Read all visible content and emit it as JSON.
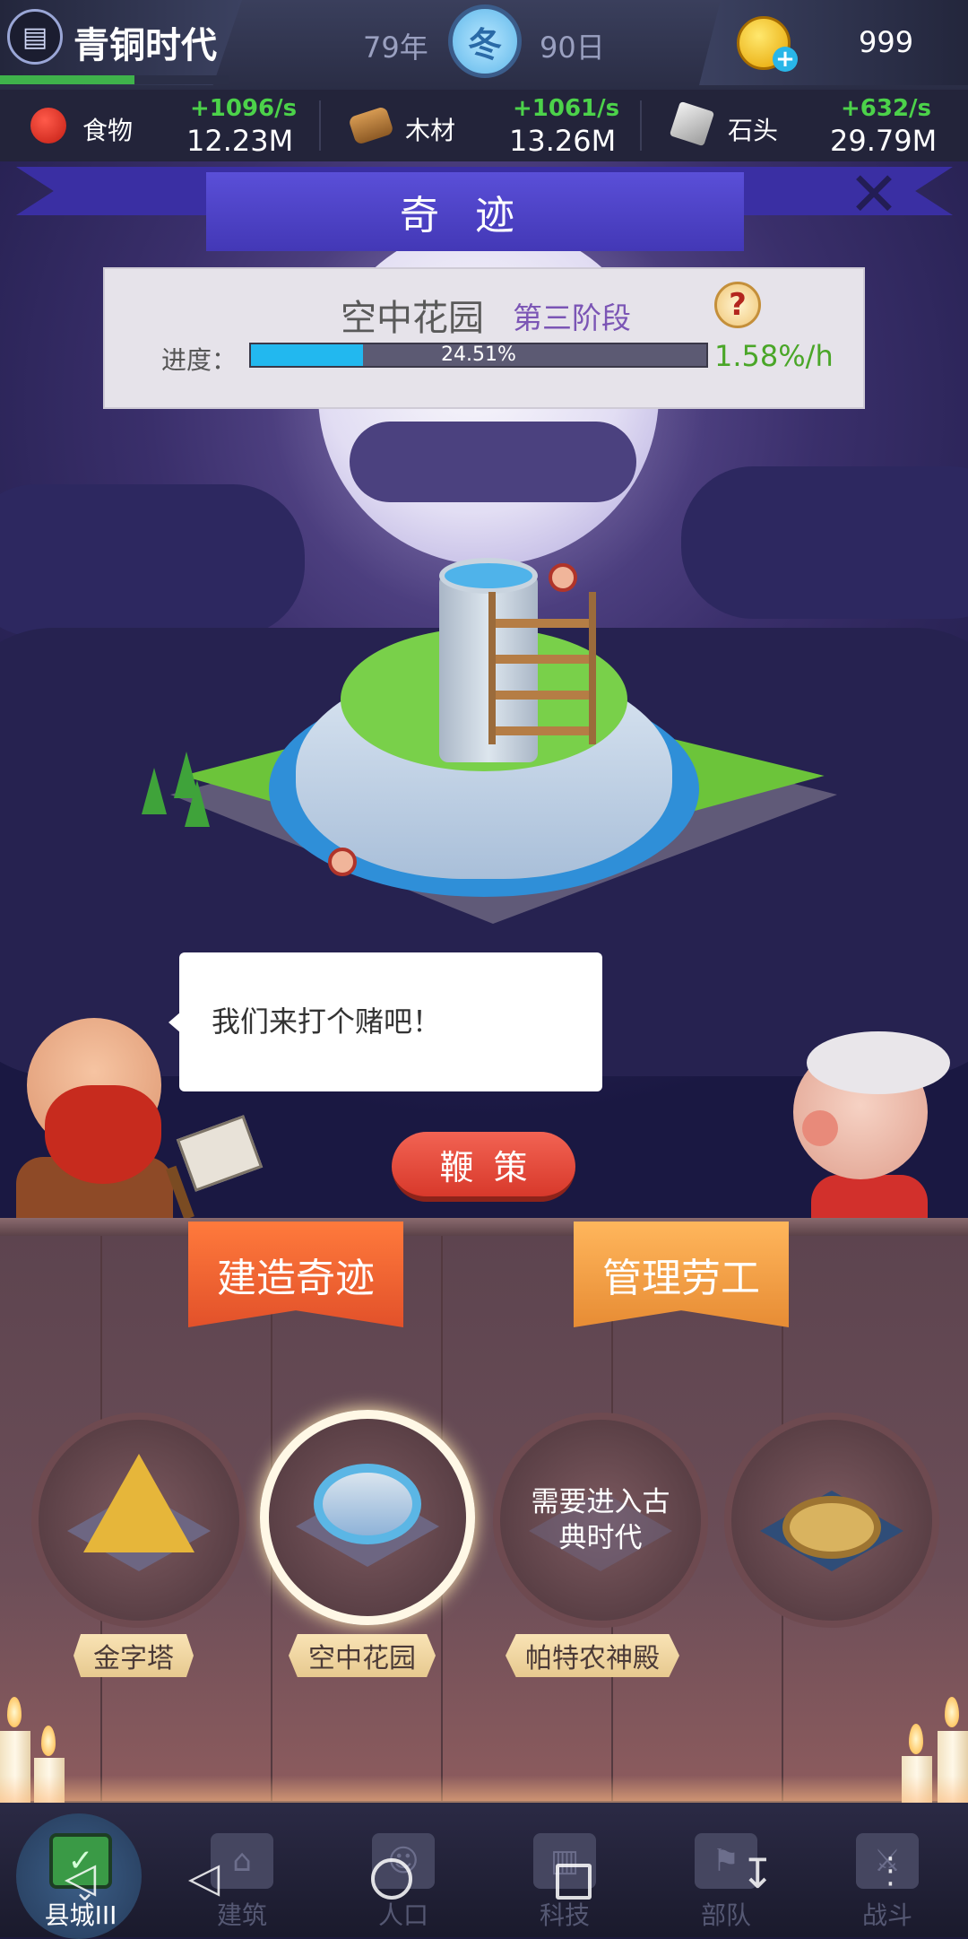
{
  "status": {
    "age_title": "青铜时代",
    "year": "79年",
    "season": "冬",
    "day": "90日",
    "coins": "999"
  },
  "resources": [
    {
      "name": "食物",
      "rate": "+1096/s",
      "total": "12.23M",
      "icon": "apple-icon"
    },
    {
      "name": "木材",
      "rate": "+1061/s",
      "total": "13.26M",
      "icon": "wood-log-icon"
    },
    {
      "name": "石头",
      "rate": "+632/s",
      "total": "29.79M",
      "icon": "stone-icon"
    }
  ],
  "banner": {
    "title": "奇迹"
  },
  "wonder": {
    "name": "空中花园",
    "stage": "第三阶段",
    "progress_label": "进度：",
    "progress_text": "24.51%",
    "progress_value": 0.2451,
    "rate": "1.58%/h"
  },
  "speech": {
    "text": "我们来打个赌吧！"
  },
  "actions": {
    "whip": "鞭策",
    "build": "建造奇迹",
    "manage": "管理劳工"
  },
  "wonders": [
    {
      "label": "金字塔"
    },
    {
      "label": "空中花园",
      "selected": true
    },
    {
      "label": "帕特农神殿",
      "locked_text": "需要进入古典时代"
    },
    {
      "label": ""
    }
  ],
  "nav": [
    {
      "label": "县城III",
      "active": true
    },
    {
      "label": "建筑"
    },
    {
      "label": "人口"
    },
    {
      "label": "科技"
    },
    {
      "label": "部队"
    },
    {
      "label": "战斗"
    }
  ],
  "colors": {
    "rate_green": "#4cd24a",
    "progress_blue": "#22b8ef",
    "banner_purple": "#4a3fc8",
    "build_orange": "#e2512a",
    "manage_orange": "#e78c34",
    "whip_red": "#d8392b"
  }
}
